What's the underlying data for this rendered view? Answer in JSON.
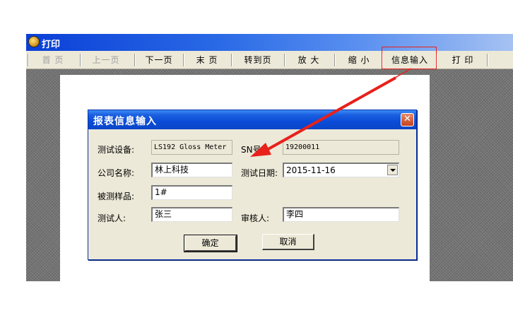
{
  "print_window": {
    "title": "打印",
    "toolbar": [
      {
        "id": "first",
        "label": "首 页",
        "disabled": true
      },
      {
        "id": "prev",
        "label": "上一页",
        "disabled": true
      },
      {
        "id": "next",
        "label": "下一页",
        "disabled": false
      },
      {
        "id": "last",
        "label": "末 页",
        "disabled": false
      },
      {
        "id": "goto",
        "label": "转到页",
        "disabled": false
      },
      {
        "id": "zoom-in",
        "label": "放 大",
        "disabled": false
      },
      {
        "id": "zoom-out",
        "label": "缩 小",
        "disabled": false
      },
      {
        "id": "info-input",
        "label": "信息输入",
        "disabled": false
      },
      {
        "id": "print",
        "label": "打 印",
        "disabled": false
      }
    ]
  },
  "dialog": {
    "title": "报表信息输入",
    "fields": {
      "device_label": "测试设备:",
      "device_value": "LS192 Gloss Meter",
      "sn_label": "SN号:",
      "sn_value": "19200011",
      "company_label": "公司名称:",
      "company_value": "林上科技",
      "date_label": "测试日期:",
      "date_value": "2015-11-16",
      "sample_label": "被测样品:",
      "sample_value": "1#",
      "tester_label": "测试人:",
      "tester_value": "张三",
      "reviewer_label": "审核人:",
      "reviewer_value": "李四"
    },
    "ok_label": "确定",
    "cancel_label": "取消"
  },
  "colors": {
    "annotation_red": "#e8211b",
    "titlebar_blue": "#0b4bd6"
  }
}
